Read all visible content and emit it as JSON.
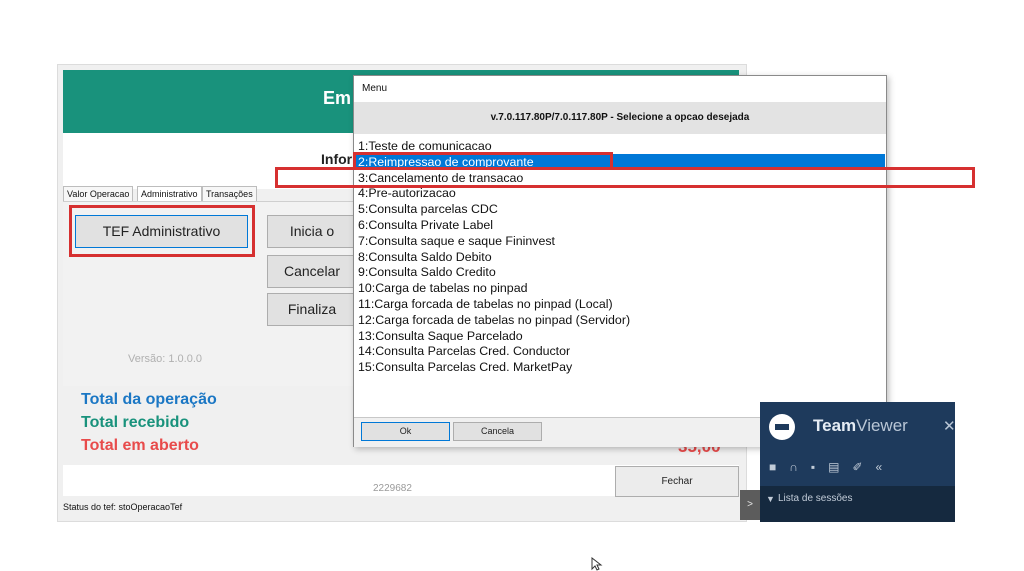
{
  "app": {
    "header_title": "Em",
    "info_label": "Infor",
    "tabs": [
      "Valor Operacao",
      "Administrativo",
      "Transações"
    ],
    "tef_admin_label": "TEF Administrativo",
    "inicia_label": "Inicia o",
    "cancelar_label": "Cancelar",
    "finaliza_label": "Finaliza",
    "version_label": "Versão: 1.0.0.0",
    "totals": {
      "operacao": "Total da operação",
      "recebido": "Total recebido",
      "aberto": "Total em aberto",
      "aberto_value": "35,00"
    },
    "op_number": "2229682",
    "fechar_label": "Fechar",
    "status": "Status do tef: stoOperacaoTef"
  },
  "menu": {
    "title": "Menu",
    "subtitle": "v.7.0.117.80P/7.0.117.80P - Selecione a opcao desejada",
    "selected_index": 1,
    "items": [
      "1:Teste de comunicacao",
      "2:Reimpressao de comprovante",
      "3:Cancelamento de transacao",
      "4:Pre-autorizacao",
      "5:Consulta parcelas CDC",
      "6:Consulta Private Label",
      "7:Consulta saque e saque Fininvest",
      "8:Consulta Saldo Debito",
      "9:Consulta Saldo Credito",
      "10:Carga de tabelas no pinpad",
      "11:Carga forcada de tabelas no pinpad (Local)",
      "12:Carga forcada de tabelas no pinpad (Servidor)",
      "13:Consulta Saque Parcelado",
      "14:Consulta Parcelas Cred. Conductor",
      "15:Consulta Parcelas Cred. MarketPay"
    ],
    "ok_label": "Ok",
    "cancel_label": "Cancela"
  },
  "teamviewer": {
    "name_bold": "Team",
    "name_rest": "Viewer",
    "close": "✕",
    "list_label": "Lista de sessões",
    "list_arrow": "▼",
    "side_arrow": ">",
    "tools_icons": [
      "camera-icon",
      "headset-icon",
      "chat-icon",
      "files-icon",
      "brush-icon",
      "collapse-icon"
    ]
  },
  "colors": {
    "header": "#19927c",
    "selection": "#0078d7",
    "highlight": "#d63030"
  }
}
